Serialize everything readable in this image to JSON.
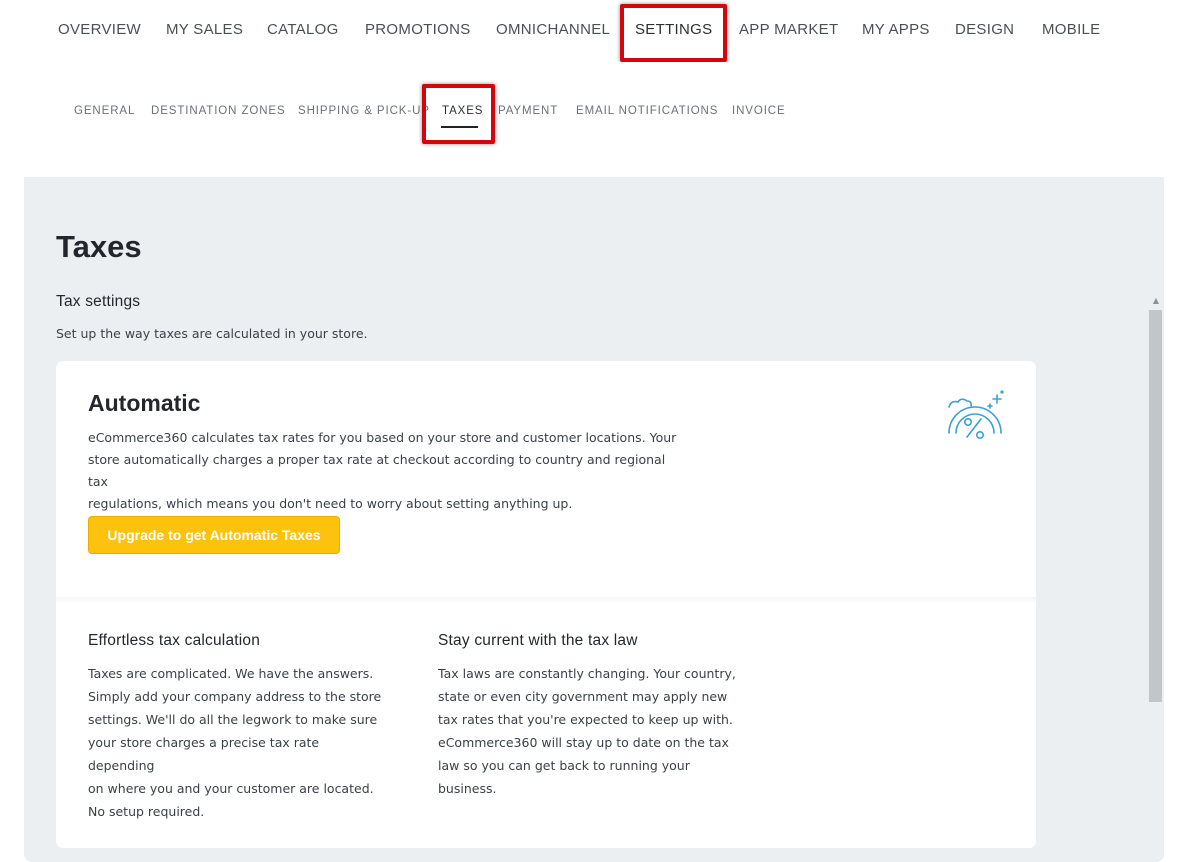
{
  "top_nav": {
    "items": [
      "OVERVIEW",
      "MY SALES",
      "CATALOG",
      "PROMOTIONS",
      "OMNICHANNEL",
      "SETTINGS",
      "APP MARKET",
      "MY APPS",
      "DESIGN",
      "MOBILE"
    ],
    "active": "SETTINGS"
  },
  "sub_nav": {
    "items": [
      "GENERAL",
      "DESTINATION ZONES",
      "SHIPPING & PICK-UP",
      "TAXES",
      "PAYMENT",
      "EMAIL NOTIFICATIONS",
      "INVOICE"
    ],
    "active": "TAXES"
  },
  "page": {
    "title": "Taxes",
    "section_title": "Tax settings",
    "section_desc": "Set up the way taxes are calculated in your store."
  },
  "card": {
    "title": "Automatic",
    "text_lines": [
      "eCommerce360 calculates tax rates for you based on your store and customer locations. Your",
      "store automatically charges a proper tax rate at checkout according to country and regional tax",
      "regulations, which means you don't need to worry about setting anything up."
    ],
    "button_label": "Upgrade to get Automatic Taxes",
    "icon": "tax-percent-gauge-icon"
  },
  "features": [
    {
      "title": "Effortless tax calculation",
      "lines": [
        "Taxes are complicated. We have the answers.",
        "Simply add your company address to the store",
        "settings. We'll do all the legwork to make sure",
        "your store charges a precise tax rate depending",
        "on where you and your customer are located.",
        "No setup required."
      ]
    },
    {
      "title": "Stay current with the tax law",
      "lines": [
        "Tax laws are constantly changing. Your country,",
        "state or even city government may apply new",
        "tax rates that you're expected to keep up with.",
        "eCommerce360 will stay up to date on the tax",
        "law so you can get back to running your",
        "business."
      ]
    }
  ],
  "colors": {
    "highlight": "#d0080d",
    "button": "#fcc20e",
    "content_bg": "#eceff2",
    "icon": "#3a9fd6"
  }
}
